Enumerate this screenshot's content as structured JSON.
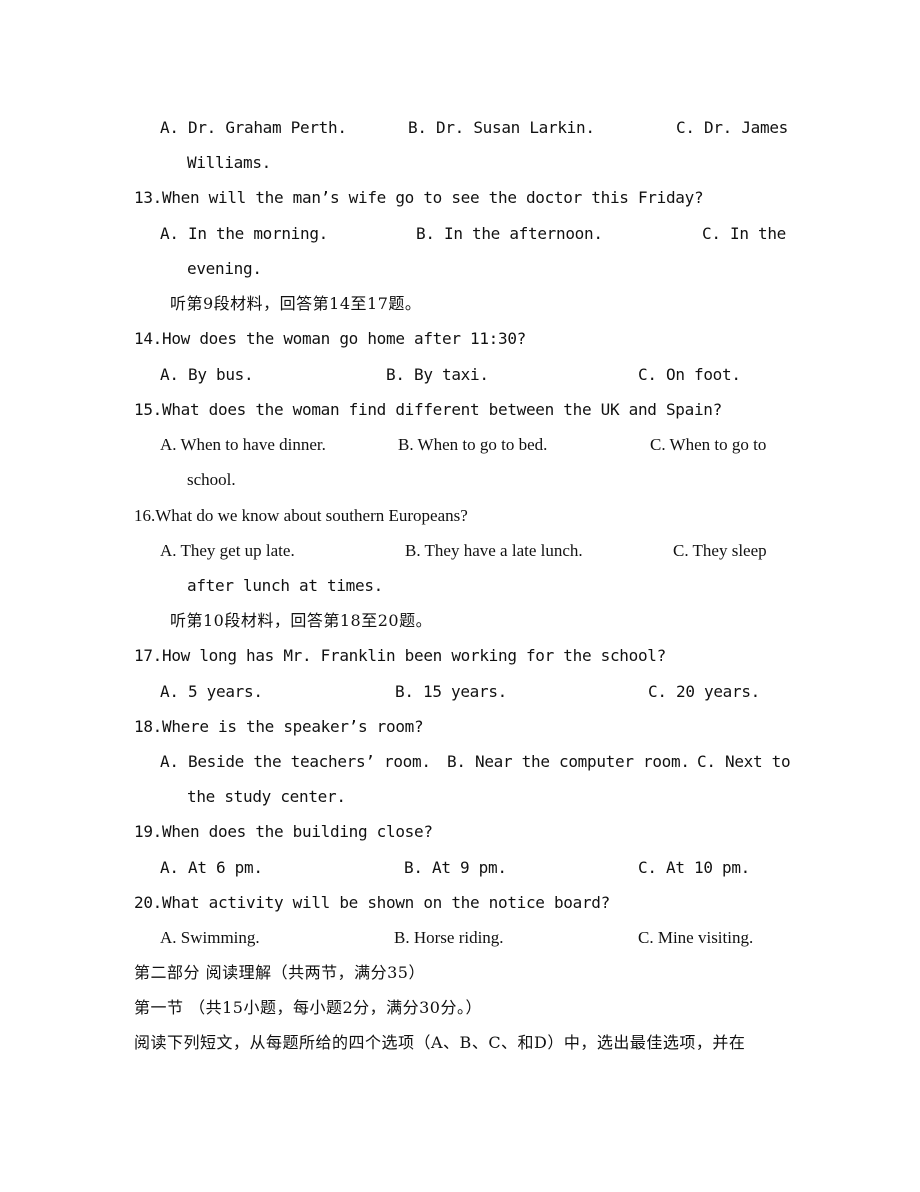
{
  "q12": {
    "options": {
      "a": "A. Dr. Graham Perth.",
      "b": "B. Dr. Susan Larkin.",
      "c": "C. Dr. James",
      "c_cont": "Williams."
    }
  },
  "q13": {
    "question": "13.When will the man’s wife go to see the doctor this Friday?",
    "options": {
      "a": "A. In the morning.",
      "b": "B. In the afternoon.",
      "c": "C. In the",
      "c_cont": "evening."
    }
  },
  "section9_instruction": "听第9段材料，回答第14至17题。",
  "q14": {
    "question": "14.How does the woman go home after 11:30?",
    "options": {
      "a": "A. By bus.",
      "b": "B. By taxi.",
      "c": "C. On foot."
    }
  },
  "q15": {
    "question": "15.What does the woman find different between the UK and Spain?",
    "options": {
      "a": "A. When to have dinner.",
      "b": "B. When to go to bed.",
      "c": "C. When to go to",
      "c_cont": "school."
    }
  },
  "q16": {
    "question": "16.What do we know about southern Europeans?",
    "options": {
      "a": "A. They get up late.",
      "b": "B. They have a late lunch.",
      "c": "C. They sleep",
      "c_cont": "after lunch at times."
    }
  },
  "section10_instruction": "听第10段材料，回答第18至20题。",
  "q17": {
    "question": "17.How long has Mr. Franklin been working for the school?",
    "options": {
      "a": "A. 5 years.",
      "b": "B. 15 years.",
      "c": "C. 20 years."
    }
  },
  "q18": {
    "question": "18.Where is the speaker’s room?",
    "options": {
      "a": "A. Beside the teachers’ room.",
      "b": "B. Near the computer room.",
      "c": "C. Next to",
      "c_cont": "the study center."
    }
  },
  "q19": {
    "question": "19.When does the building close?",
    "options": {
      "a": "A. At 6 pm.",
      "b": "B. At 9 pm.",
      "c": "C. At 10 pm."
    }
  },
  "q20": {
    "question": "20.What activity will be shown on the notice board?",
    "options": {
      "a": "A. Swimming.",
      "b": "B. Horse riding.",
      "c": "C. Mine visiting."
    }
  },
  "part2": {
    "heading": "第二部分 阅读理解（共两节，满分35）",
    "section1_heading": "第一节 （共15小题，每小题2分，满分30分。）",
    "instructions": "阅读下列短文，从每题所给的四个选项（A、B、C、和D）中，选出最佳选项，并在"
  }
}
